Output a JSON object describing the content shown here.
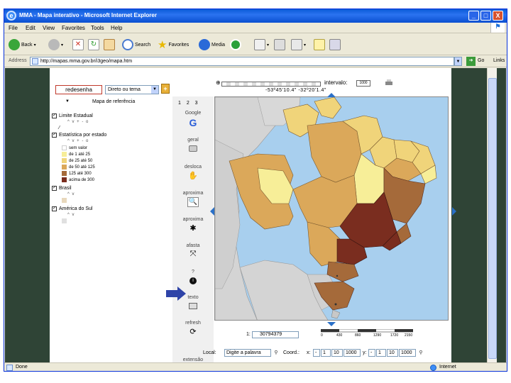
{
  "window": {
    "title": "MMA - Mapa interativo - Microsoft Internet Explorer",
    "buttons": {
      "minimize": "_",
      "maximize": "□",
      "close": "X"
    }
  },
  "menubar": {
    "items": [
      "File",
      "Edit",
      "View",
      "Favorites",
      "Tools",
      "Help"
    ]
  },
  "toolbar": {
    "back": "Back",
    "search": "Search",
    "favorites": "Favorites",
    "media": "Media"
  },
  "address": {
    "label": "Address",
    "url": "http://mapas.mma.gov.br/i3geo/mapa.htm",
    "go": "Go",
    "links": "Links"
  },
  "map_controls": {
    "redraw_button": "redesenha",
    "mode_select": "Direto ou tema",
    "reference_map": "Mapa de referência",
    "interval_label": "intervalo:",
    "interval_value": "1000",
    "coordinates": "-53º45'10.4\" -32º20'1.4\"",
    "scale_prefix": "1:",
    "scale_value": "30794379",
    "scale_ticks": [
      "0",
      "430",
      "860",
      "1290",
      "1720",
      "2150"
    ],
    "find_label": "Local:",
    "find_placeholder": "Digite a palavra",
    "coord_label": "Coord.:",
    "x_label": "x:",
    "x_fields": [
      "-",
      "1",
      "10",
      "1000"
    ],
    "y_label": "y:",
    "y_fields": [
      "-",
      "1",
      "10",
      "1000"
    ]
  },
  "legend": {
    "layers": [
      {
        "name": "Limite Estadual",
        "checked": true
      },
      {
        "name": "Estatística por estado",
        "checked": true
      },
      {
        "name": "Brasil",
        "checked": true
      },
      {
        "name": "América do Sul",
        "checked": true
      }
    ],
    "layer_controls": "^ v + - o",
    "classes": [
      {
        "label": "sem valor",
        "color": "#ffffff"
      },
      {
        "label": "de 1 até 25",
        "color": "#f7ee98"
      },
      {
        "label": "de 25 até 50",
        "color": "#f0d47a"
      },
      {
        "label": "de 50 até 125",
        "color": "#dba85a"
      },
      {
        "label": "125 até 300",
        "color": "#a56a3a"
      },
      {
        "label": "acima de 300",
        "color": "#7a2d1f"
      }
    ],
    "brasil_swatch": "#e8d8bc",
    "america_swatch": "#e0e0e0",
    "america_controls": "^ v"
  },
  "tools": {
    "numbers": "1 2 3",
    "items": [
      {
        "label": "Google",
        "icon": "google-icon"
      },
      {
        "label": "geral",
        "icon": "printer-icon"
      },
      {
        "label": "desloca",
        "icon": "pan-icon"
      },
      {
        "label": "aproxima",
        "icon": "zoom-in-icon"
      },
      {
        "label": "aproxima",
        "icon": "shrink-icon"
      },
      {
        "label": "afasta",
        "icon": "expand-icon"
      },
      {
        "label": "?",
        "icon": "info-icon"
      },
      {
        "label": "texto",
        "icon": "text-icon"
      },
      {
        "label": "refresh",
        "icon": "refresh-icon"
      }
    ],
    "extent_label": "extensão"
  },
  "status": {
    "left": "Done",
    "zone": "Internet"
  },
  "colors": {
    "ocean": "#a8cfee",
    "land_other": "#d4d4d4",
    "pale": "#f7ee98",
    "light": "#f0d47a",
    "mid": "#dba85a",
    "dark": "#a56a3a",
    "darkest": "#7a2d1f",
    "arrow_blue": "#2f44a8",
    "page_bg": "#2f4436"
  }
}
